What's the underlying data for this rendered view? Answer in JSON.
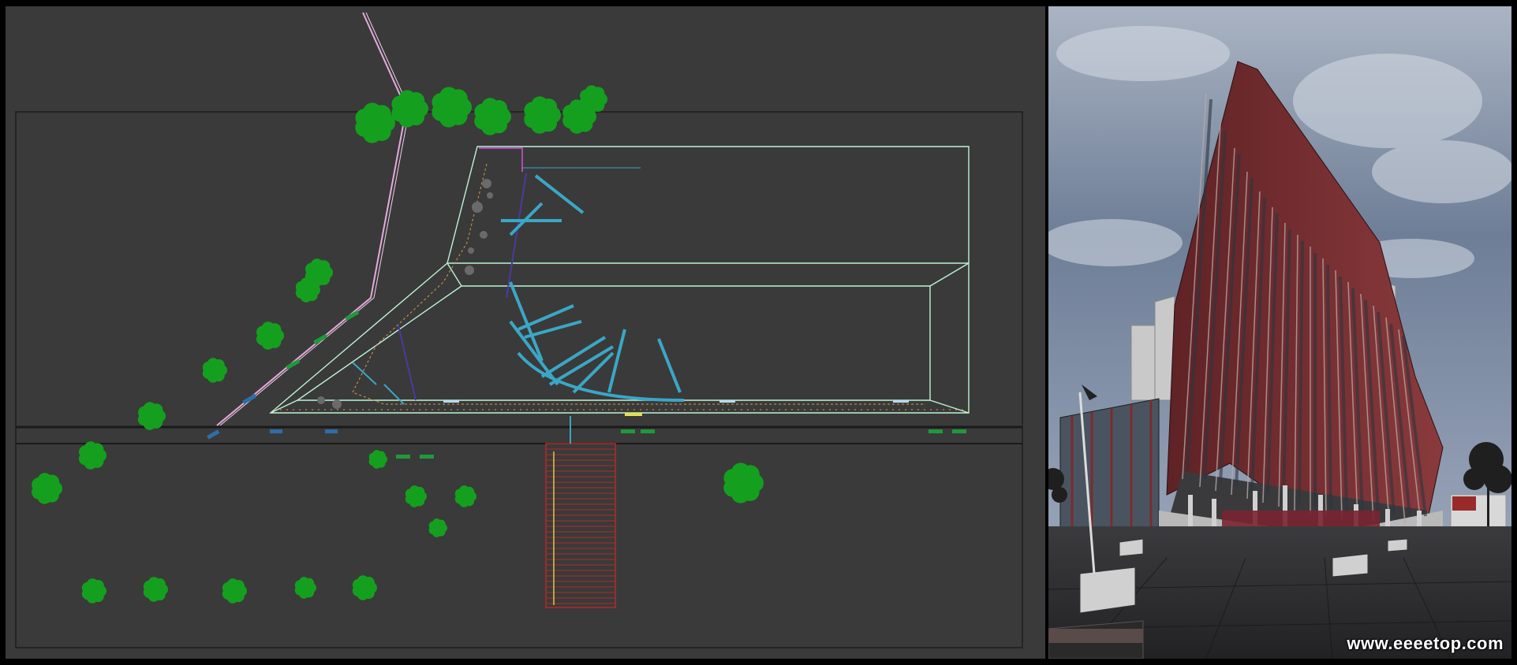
{
  "viewports": {
    "top": {
      "name": "top-view-viewport"
    },
    "perspective": {
      "name": "perspective-viewport"
    }
  },
  "watermark": {
    "text": "www.eeeetop.com"
  },
  "colors": {
    "viewport_bg": "#3a3a3a",
    "tree_green": "#14a01e",
    "outline_cyan": "#bdf3d6",
    "beam_cyan": "#3aa7c6",
    "path_pink": "#e8a9e0",
    "facade_red": "#7a2b2e",
    "sky": "#7c8aa0",
    "pavement": "#2b2b2d"
  }
}
